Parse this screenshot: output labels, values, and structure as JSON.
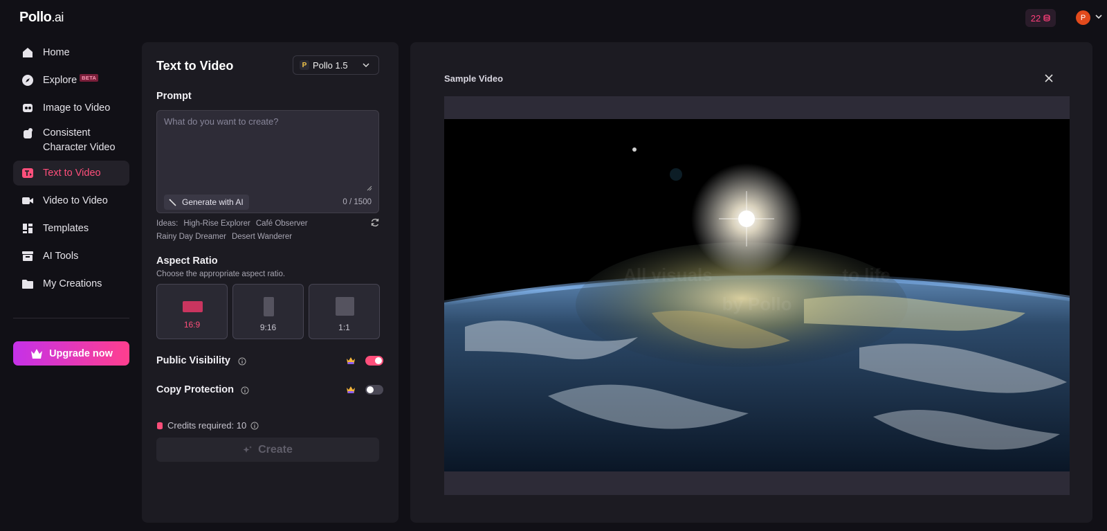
{
  "app": {
    "logo_main": "Pollo",
    "logo_suffix": ".ai"
  },
  "header": {
    "credits": "22",
    "avatar_initial": "P"
  },
  "sidebar": {
    "items": [
      {
        "label": "Home",
        "icon": "home-icon"
      },
      {
        "label": "Explore",
        "icon": "compass-icon",
        "badge": "BETA"
      },
      {
        "label": "Image to Video",
        "icon": "image-video-icon"
      },
      {
        "label": "Consistent Character Video",
        "icon": "character-icon"
      },
      {
        "label": "Text to Video",
        "icon": "text-video-icon",
        "active": true
      },
      {
        "label": "Video to Video",
        "icon": "video-camera-icon"
      },
      {
        "label": "Templates",
        "icon": "templates-icon"
      },
      {
        "label": "AI Tools",
        "icon": "ai-tools-icon"
      },
      {
        "label": "My Creations",
        "icon": "folder-icon"
      }
    ],
    "upgrade_label": "Upgrade now"
  },
  "panel": {
    "title": "Text to Video",
    "model": "Pollo 1.5",
    "prompt_label": "Prompt",
    "prompt_placeholder": "What do you want to create?",
    "prompt_value": "",
    "generate_ai_label": "Generate with AI",
    "char_count": "0 / 1500",
    "ideas_label": "Ideas:",
    "ideas": [
      "High-Rise Explorer",
      "Café Observer",
      "Rainy Day Dreamer",
      "Desert Wanderer"
    ],
    "aspect_label": "Aspect Ratio",
    "aspect_hint": "Choose the appropriate aspect ratio.",
    "ratios": [
      {
        "label": "16:9",
        "selected": true
      },
      {
        "label": "9:16",
        "selected": false
      },
      {
        "label": "1:1",
        "selected": false
      }
    ],
    "public_visibility_label": "Public Visibility",
    "public_visibility_on": true,
    "copy_protection_label": "Copy Protection",
    "copy_protection_on": false,
    "credits_required": "Credits required: 10",
    "create_label": "Create"
  },
  "preview": {
    "title": "Sample Video",
    "watermark_line1": "All visuals",
    "watermark_line2": "to life",
    "watermark_line3": "by Pollo"
  },
  "colors": {
    "accent": "#ff4f7b",
    "upgrade_start": "#c531e8",
    "upgrade_end": "#ff3f8e"
  }
}
